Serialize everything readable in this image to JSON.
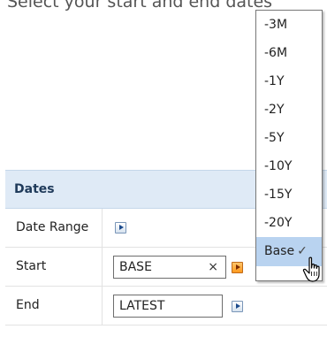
{
  "instruction": "Select your start and end dates",
  "panel": {
    "title": "Dates",
    "rows": {
      "date_range": {
        "label": "Date Range"
      },
      "start": {
        "label": "Start",
        "value": "BASE",
        "clear": "×"
      },
      "end": {
        "label": "End",
        "value": "LATEST"
      }
    }
  },
  "dropdown": {
    "items": [
      "-3M",
      "-6M",
      "-1Y",
      "-2Y",
      "-5Y",
      "-10Y",
      "-15Y",
      "-20Y",
      "Base"
    ],
    "selected": "Base",
    "selected_check": "✓"
  },
  "colors": {
    "header_bg": "#dfeaf6",
    "selected_bg": "#b9d3f0",
    "accent_orange": "#ff9a1e"
  },
  "icons": [
    "arrow-right-icon",
    "clear-icon",
    "checkmark-icon",
    "hand-cursor-icon"
  ]
}
